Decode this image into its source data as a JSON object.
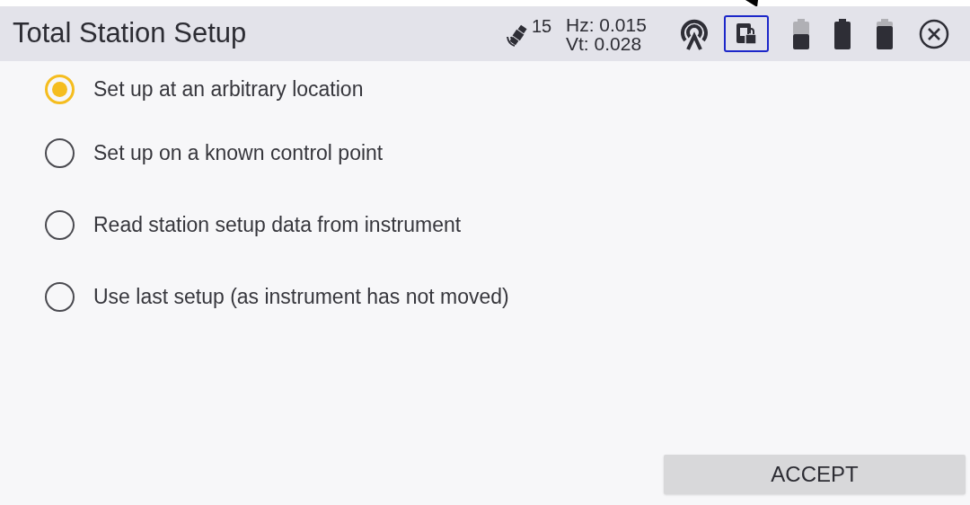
{
  "title_bar": {
    "title": "Total Station Setup",
    "satellite_count": "15",
    "hz": "Hz: 0.015",
    "vt": "Vt: 0.028"
  },
  "options": [
    {
      "label": "Set up at an arbitrary location",
      "selected": true
    },
    {
      "label": "Set up on a known control point",
      "selected": false
    },
    {
      "label": "Read station setup data from instrument",
      "selected": false
    },
    {
      "label": "Use last setup (as instrument has not moved)",
      "selected": false
    }
  ],
  "accept_button": "ACCEPT"
}
